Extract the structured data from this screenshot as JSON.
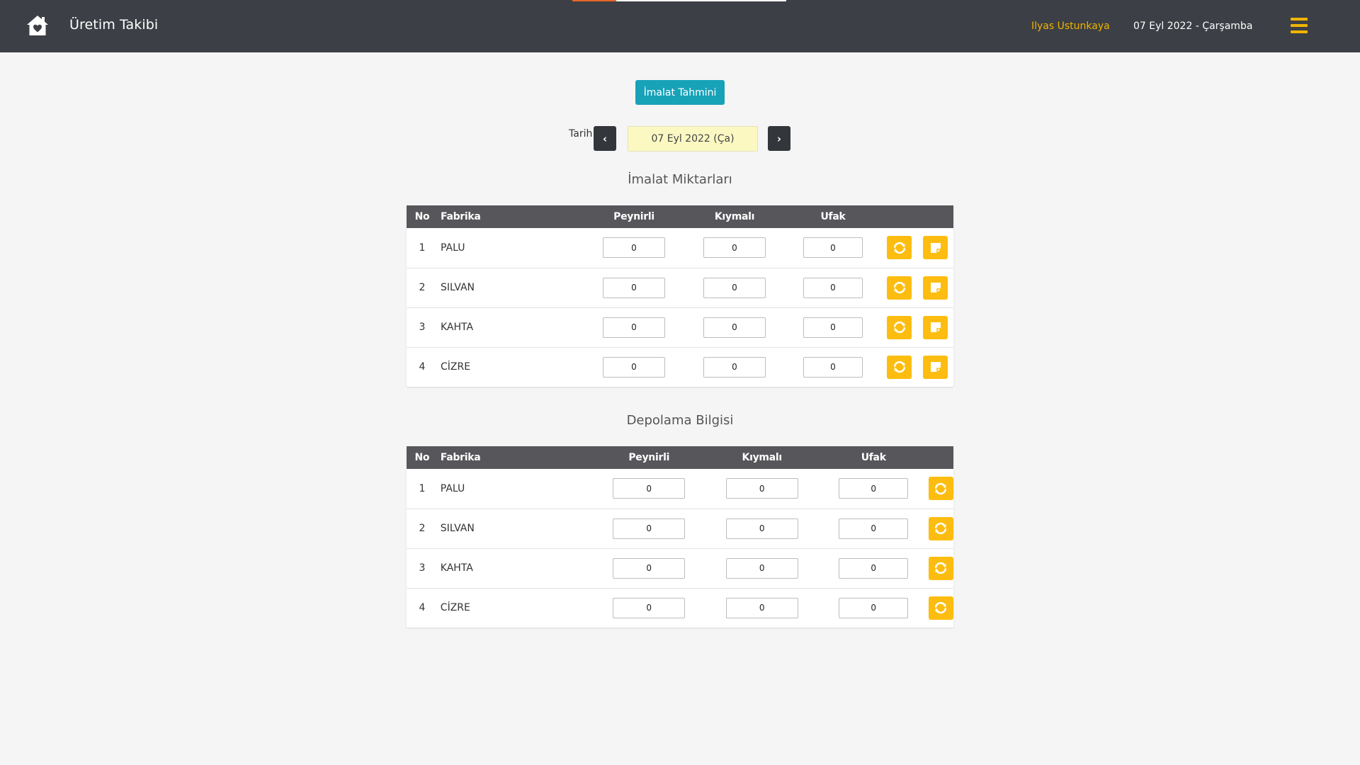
{
  "app": {
    "title": "Üretim Takibi",
    "user": "Ilyas Ustunkaya",
    "date": "07 Eyl 2022 - Çarşamba"
  },
  "toolbar": {
    "forecast_label": "İmalat Tahmini"
  },
  "date_picker": {
    "label": "Tarih",
    "value": "07 Eyl 2022 (Ça)",
    "prev": "‹",
    "next": "›"
  },
  "production": {
    "title": "İmalat Miktarları",
    "headers": {
      "no": "No",
      "factory": "Fabrika",
      "peynirli": "Peynirli",
      "kiymali": "Kıymalı",
      "ufak": "Ufak"
    },
    "rows": [
      {
        "no": "1",
        "factory": "PALU",
        "peynirli": "0",
        "kiymali": "0",
        "ufak": "0"
      },
      {
        "no": "2",
        "factory": "SILVAN",
        "peynirli": "0",
        "kiymali": "0",
        "ufak": "0"
      },
      {
        "no": "3",
        "factory": "KAHTA",
        "peynirli": "0",
        "kiymali": "0",
        "ufak": "0"
      },
      {
        "no": "4",
        "factory": "CİZRE",
        "peynirli": "0",
        "kiymali": "0",
        "ufak": "0"
      }
    ]
  },
  "storage": {
    "title": "Depolama Bilgisi",
    "headers": {
      "no": "No",
      "factory": "Fabrika",
      "peynirli": "Peynirli",
      "kiymali": "Kıymalı",
      "ufak": "Ufak"
    },
    "rows": [
      {
        "no": "1",
        "factory": "PALU",
        "peynirli": "0",
        "kiymali": "0",
        "ufak": "0"
      },
      {
        "no": "2",
        "factory": "SILVAN",
        "peynirli": "0",
        "kiymali": "0",
        "ufak": "0"
      },
      {
        "no": "3",
        "factory": "KAHTA",
        "peynirli": "0",
        "kiymali": "0",
        "ufak": "0"
      },
      {
        "no": "4",
        "factory": "CİZRE",
        "peynirli": "0",
        "kiymali": "0",
        "ufak": "0"
      }
    ]
  },
  "icons": {
    "home": "home-icon",
    "menu": "hamburger-menu-icon",
    "refresh": "refresh-icon",
    "note": "note-icon"
  },
  "colors": {
    "navbar": "#3c3f45",
    "accent": "#f0b400",
    "forecast_button": "#17a2b8",
    "action_button": "#fdbd10",
    "table_header": "#57565a",
    "date_field": "#fbf8c2"
  }
}
